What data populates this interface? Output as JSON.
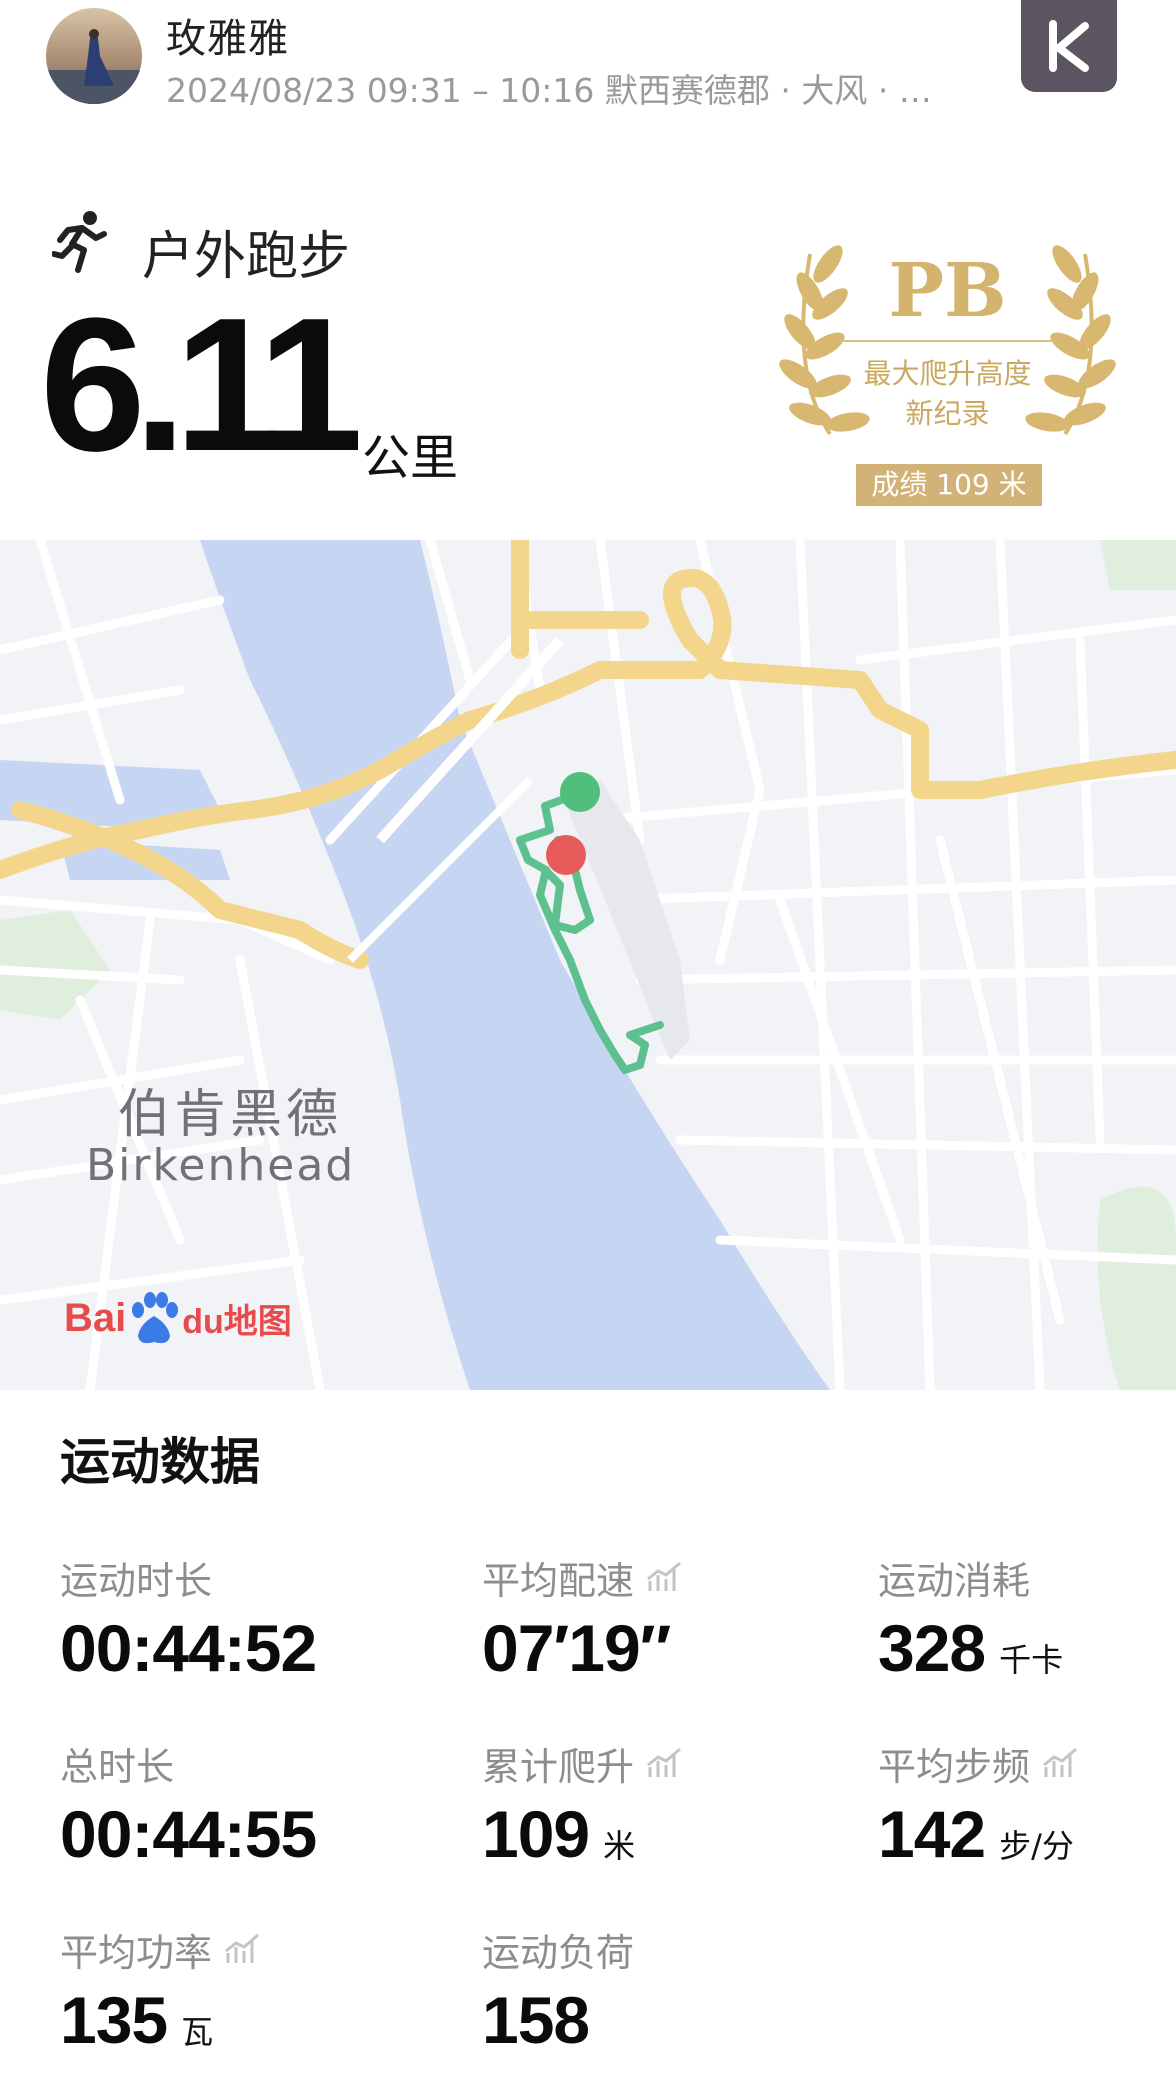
{
  "header": {
    "username": "玫雅雅",
    "meta": "2024/08/23 09:31 – 10:16 默西赛德郡 · 大风 · …",
    "app_icon": "keep-k-logo"
  },
  "activity": {
    "type": "户外跑步",
    "icon": "running-person-icon",
    "distance": "6.11",
    "distance_unit": "公里"
  },
  "pb_badge": {
    "title": "PB",
    "line1": "最大爬升高度",
    "line2": "新纪录",
    "score": "成绩 109 米",
    "color": "#d4b46c"
  },
  "map": {
    "city_cn": "伯肯黑德",
    "city_en": "Birkenhead",
    "provider_logo_text": "Bai",
    "provider_logo_suffix": "du地图",
    "start_color": "#4fbf7b",
    "end_color": "#e85b5b",
    "route_color": "#5cc08f",
    "water_color": "#c6d6f2",
    "road_color": "#f3d58c"
  },
  "stats": {
    "title": "运动数据",
    "items": [
      {
        "label": "运动时长",
        "value": "00:44:52",
        "unit": "",
        "has_chart_icon": false
      },
      {
        "label": "平均配速",
        "value": "07′19″",
        "unit": "",
        "has_chart_icon": true
      },
      {
        "label": "运动消耗",
        "value": "328",
        "unit": "千卡",
        "has_chart_icon": false
      },
      {
        "label": "总时长",
        "value": "00:44:55",
        "unit": "",
        "has_chart_icon": false
      },
      {
        "label": "累计爬升",
        "value": "109",
        "unit": "米",
        "has_chart_icon": true
      },
      {
        "label": "平均步频",
        "value": "142",
        "unit": "步/分",
        "has_chart_icon": true
      },
      {
        "label": "平均功率",
        "value": "135",
        "unit": "瓦",
        "has_chart_icon": true
      },
      {
        "label": "运动负荷",
        "value": "158",
        "unit": "",
        "has_chart_icon": false
      }
    ]
  }
}
